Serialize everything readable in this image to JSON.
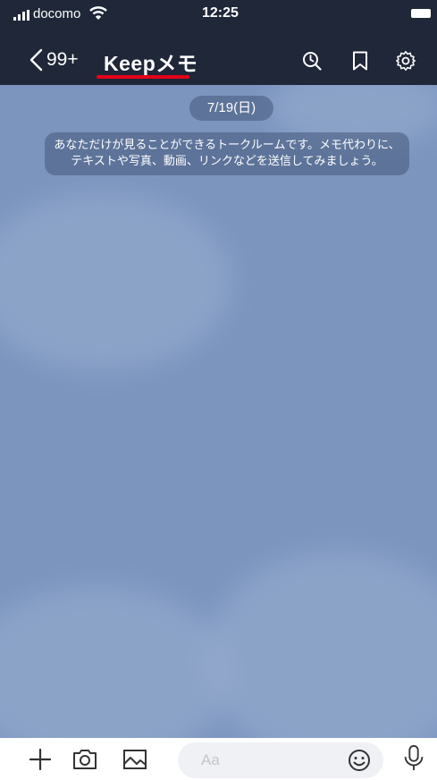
{
  "status_bar": {
    "carrier": "docomo",
    "time": "12:25",
    "icons": [
      "signal-icon",
      "wifi-icon",
      "battery-icon"
    ]
  },
  "nav": {
    "unread_count": "99+",
    "title": "Keepメモ",
    "icons": [
      "back-icon",
      "search-icon",
      "bookmark-icon",
      "gear-icon"
    ]
  },
  "chat": {
    "date": "7/19(日)",
    "system_message": "あなただけが見ることができるトークルームです。メモ代わりに、テキストや写真、動画、リンクなどを送信してみましょう。"
  },
  "input_bar": {
    "placeholder": "Aa",
    "icons": [
      "plus-icon",
      "camera-icon",
      "image-icon",
      "emoji-icon",
      "microphone-icon"
    ]
  },
  "colors": {
    "header_bg": "#1f2738",
    "chat_bg": "#7b95bf",
    "accent_underline": "#e5001a"
  }
}
